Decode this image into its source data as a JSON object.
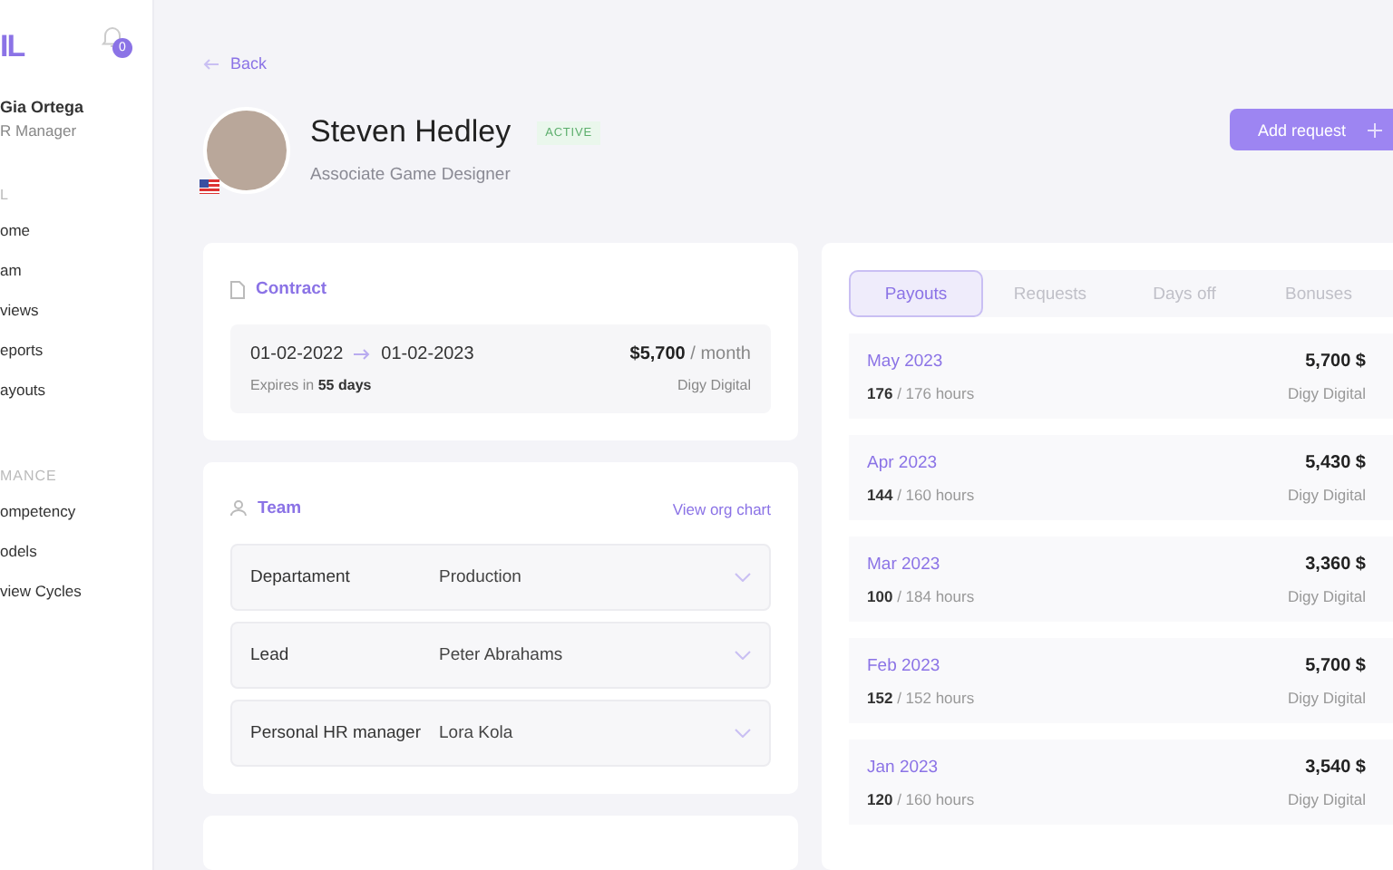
{
  "sidebar": {
    "logo": "IL",
    "notifications": "0",
    "user": {
      "name": "Gia Ortega",
      "role": "R Manager"
    },
    "sections": [
      {
        "title": "L",
        "items": [
          {
            "label": "ome",
            "selected": false
          },
          {
            "label": "am",
            "selected": false
          },
          {
            "label": "views",
            "selected": false
          },
          {
            "label": "eports",
            "selected": false
          },
          {
            "label": "ayouts",
            "selected": false
          }
        ]
      },
      {
        "title": "MANCE",
        "items": [
          {
            "label": "ompetency",
            "selected": false
          },
          {
            "label": "odels",
            "selected": false
          },
          {
            "label": "view Cycles",
            "selected": false
          }
        ]
      }
    ]
  },
  "back": "Back",
  "profile": {
    "name": "Steven Hedley",
    "status": "ACTIVE",
    "title": "Associate Game Designer"
  },
  "add_request": "Add request",
  "contract": {
    "title": "Contract",
    "start": "01-02-2022",
    "end": "01-02-2023",
    "expires": "Expires in **55 days**",
    "salary": "$5,700",
    "period": "/ month",
    "company": "Digy Digital"
  },
  "team": {
    "title": "Team",
    "link": "View org chart",
    "rows": [
      {
        "label": "Departament",
        "value": "Production",
        "expanded": false
      },
      {
        "label": "Lead",
        "value": "Peter Abrahams",
        "expanded": false
      },
      {
        "label": "Personal HR manager",
        "value": "Lora Kola",
        "expanded": false
      }
    ]
  },
  "tabs": [
    {
      "label": "Payouts",
      "selected": true
    },
    {
      "label": "Requests",
      "selected": false
    },
    {
      "label": "Days off",
      "selected": false
    },
    {
      "label": "Bonuses",
      "selected": false
    }
  ],
  "payouts": [
    {
      "month": "May 2023",
      "hours": "176",
      "total": "/ 176 hours",
      "amount": "5,700 $",
      "company": "Digy Digital"
    },
    {
      "month": "Apr 2023",
      "hours": "144",
      "total": "/ 160 hours",
      "amount": "5,430 $",
      "company": "Digy Digital"
    },
    {
      "month": "Mar 2023",
      "hours": "100",
      "total": "/ 184 hours",
      "amount": "3,360 $",
      "company": "Digy Digital"
    },
    {
      "month": "Feb 2023",
      "hours": "152",
      "total": "/ 152 hours",
      "amount": "5,700 $",
      "company": "Digy Digital"
    },
    {
      "month": "Jan 2023",
      "hours": "120",
      "total": "/ 160 hours",
      "amount": "3,540 $",
      "company": "Digy Digital"
    }
  ]
}
